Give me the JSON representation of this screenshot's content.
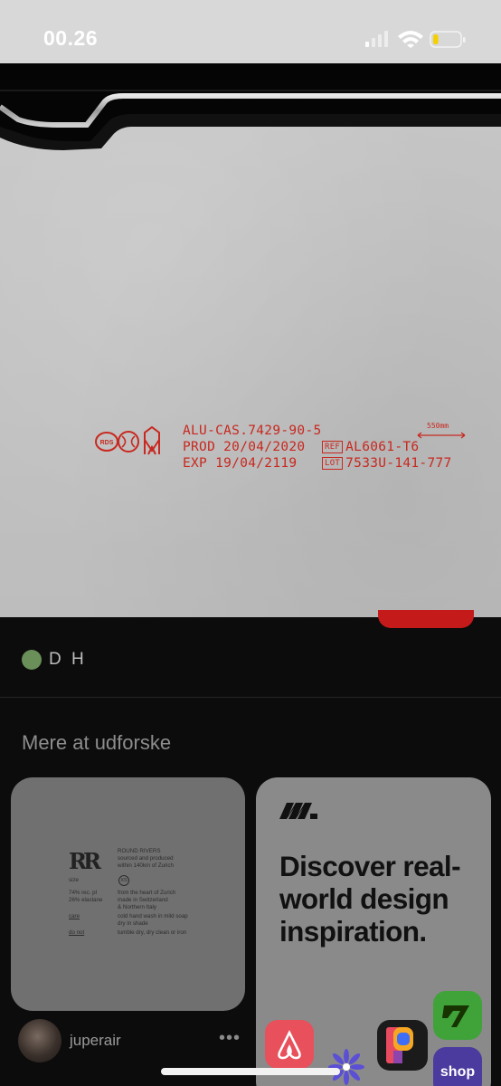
{
  "status_bar": {
    "time": "00.26",
    "battery_level": 0.2,
    "battery_color": "#f5d000"
  },
  "hero": {
    "engraving": {
      "logo_text": "RDS",
      "line1": "ALU-CAS.7429-90-5",
      "line2": "PROD 20/04/2020",
      "line3": "EXP  19/04/2119",
      "ref_tag": "REF",
      "ref_value": "AL6061-T6",
      "lot_tag": "LOT",
      "lot_value": "7533U-141-777",
      "scale_label": "550mm",
      "color": "#c8281f"
    }
  },
  "board": {
    "name": "D H",
    "dot_color": "#6a8f59"
  },
  "explore": {
    "title": "Mere at udforske"
  },
  "cards": {
    "left": {
      "label": {
        "logo": "RR",
        "brand": "ROUND RIVERS",
        "brand_sub1": "sourced and produced",
        "brand_sub2": "within 140km of Zurich",
        "size_label": "size",
        "size_value": "XS",
        "fabric1": "74% rec. pl",
        "fabric2": "26% elastane",
        "origin1": "from the heart of Zurich",
        "origin2": "made in Switzerland",
        "origin3": "& Northern Italy",
        "care_label": "care",
        "care1": "cold hand wash in mild soap",
        "care2": "dry in shade",
        "donot_label": "do not",
        "donot_value": "tumble dry, dry clean or iron"
      },
      "author": "juperair",
      "more": "•••"
    },
    "right": {
      "headline": "Discover real-world design inspiration.",
      "icons": [
        "airbnb-icon",
        "pinterest-like-icon",
        "wise-icon",
        "shop-icon",
        "flower-icon"
      ],
      "shop_label": "shop"
    }
  }
}
